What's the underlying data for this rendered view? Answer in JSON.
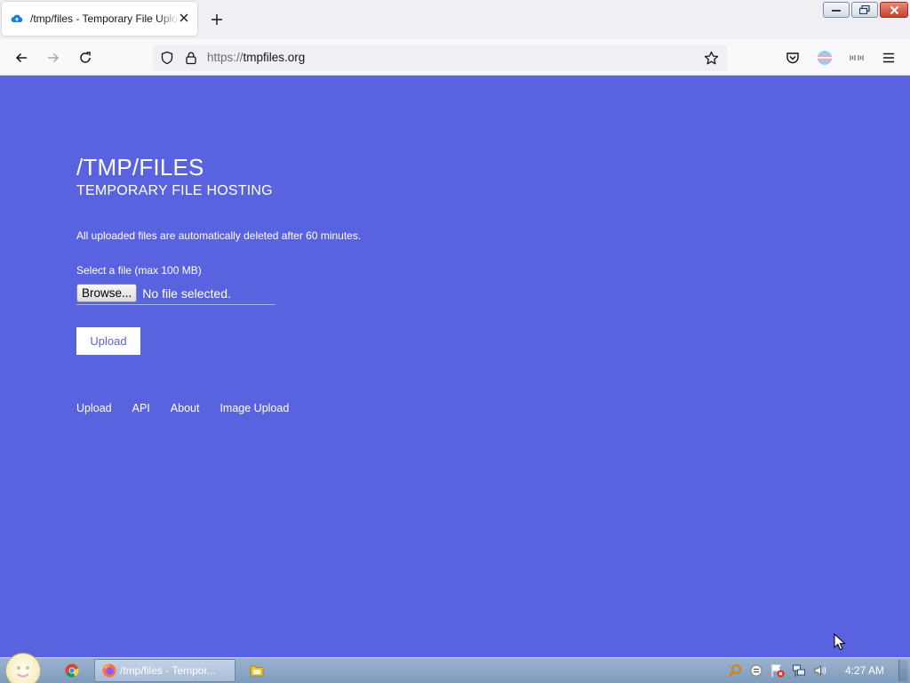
{
  "browser": {
    "tab_title": "/tmp/files - Temporary File Upload",
    "url_scheme": "https://",
    "url_host": "tmpfiles.org"
  },
  "page": {
    "title": "/TMP/FILES",
    "subtitle": "TEMPORARY FILE HOSTING",
    "notice": "All uploaded files are automatically deleted after 60 minutes.",
    "file_label": "Select a file (max 100 MB)",
    "browse_label": "Browse...",
    "file_status": "No file selected.",
    "upload_label": "Upload",
    "footer_links": [
      "Upload",
      "API",
      "About",
      "Image Upload"
    ]
  },
  "taskbar": {
    "active_task_label": "/tmp/files - Tempor...",
    "clock": "4:27 AM"
  },
  "colors": {
    "page_background": "#5a63df",
    "text": "#ffffff"
  }
}
